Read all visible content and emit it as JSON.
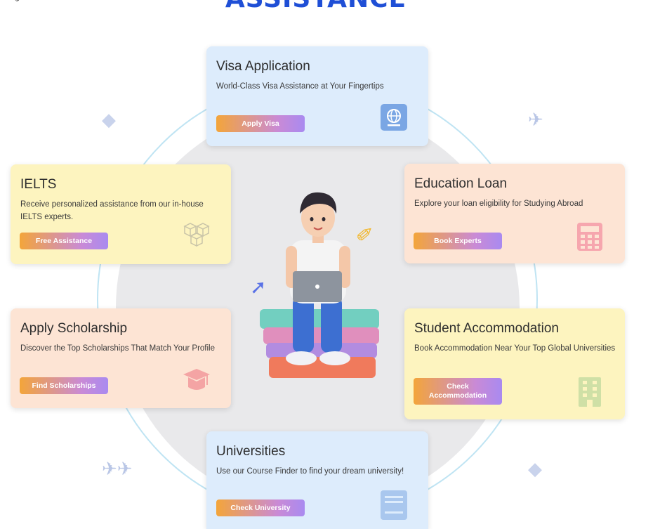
{
  "heading": "ASSISTANCE",
  "cards": {
    "visa": {
      "title": "Visa Application",
      "desc": "World-Class Visa Assistance at Your Fingertips",
      "button": "Apply Visa",
      "icon": "globe-icon"
    },
    "ielts": {
      "title": "IELTS",
      "desc": "Receive personalized assistance from our in-house IELTS experts.",
      "button": "Free Assistance",
      "icon": "cubes-icon"
    },
    "loan": {
      "title": "Education Loan",
      "desc": "Explore your loan eligibility for Studying Abroad",
      "button": "Book Experts",
      "icon": "calculator-icon"
    },
    "scholarship": {
      "title": "Apply Scholarship",
      "desc": "Discover the Top Scholarships That Match Your Profile",
      "button": "Find Scholarships",
      "icon": "graduation-cap-icon"
    },
    "accommodation": {
      "title": "Student Accommodation",
      "desc": "Book Accommodation Near Your Top Global Universities",
      "button": "Check Accommodation",
      "icon": "building-icon"
    },
    "universities": {
      "title": "Universities",
      "desc": "Use our Course Finder to find your dream university!",
      "button": "Check University",
      "icon": "book-icon"
    }
  },
  "colors": {
    "heading": "#1f4fd6",
    "card_blue": "#ddecfc",
    "card_yellow": "#fdf4bf",
    "card_peach": "#fde4d4",
    "button_from": "#f3a53a",
    "button_to": "#a98af0"
  }
}
